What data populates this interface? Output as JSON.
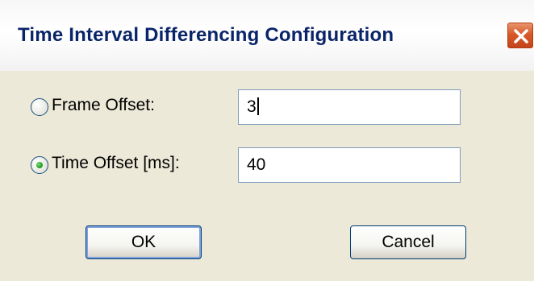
{
  "window": {
    "title": "Time Interval Differencing Configuration",
    "close_icon": "close-icon"
  },
  "frame_offset": {
    "label": "Frame Offset:",
    "value": "3",
    "selected": false
  },
  "time_offset": {
    "label": "Time Offset [ms]:",
    "value": "40",
    "selected": true
  },
  "buttons": {
    "ok_label": "OK",
    "cancel_label": "Cancel"
  },
  "colors": {
    "dialog_background": "#ece9d8",
    "title_text": "#0a246a",
    "close_button": "#d85a2a",
    "radio_selected": "#21a121",
    "input_border": "#7f9db9",
    "button_border": "#003c74"
  }
}
